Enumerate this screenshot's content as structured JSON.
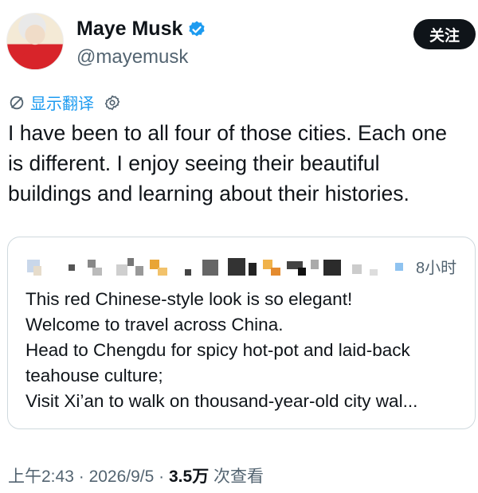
{
  "author": {
    "display_name": "Maye Musk",
    "handle": "@mayemusk",
    "verified_icon": "verified-badge-icon",
    "verified_color": "#1d9bf0"
  },
  "follow_button": {
    "label": "关注"
  },
  "translate": {
    "label": "显示翻译",
    "icon": "translate-icon",
    "settings_icon": "gear-icon"
  },
  "tweet": {
    "lines": [
      "I have been to all four of those cities. Each one",
      "is different. I enjoy seeing their beautiful",
      "buildings and learning about their histories."
    ]
  },
  "quoted_tweet": {
    "time": "8小时",
    "lines": [
      "This red Chinese-style look is so elegant!",
      "Welcome to travel across China.",
      "Head to Chengdu for spicy hot-pot and laid-back",
      "teahouse culture;",
      "Visit Xi’an to walk on thousand-year-old city wal..."
    ]
  },
  "meta": {
    "time": "上午2:43",
    "date": "2026/9/5",
    "views": "3.5万",
    "views_label": "次查看",
    "separator": "·"
  },
  "colors": {
    "accent": "#1d9bf0",
    "text": "#0f1419",
    "muted": "#536471",
    "border": "#cfd9de"
  }
}
